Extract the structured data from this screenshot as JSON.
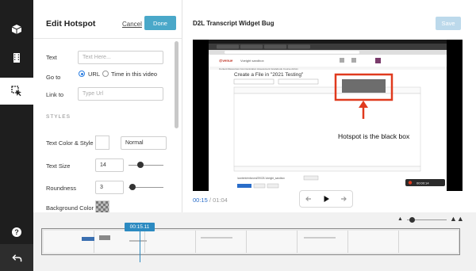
{
  "edit_panel": {
    "title": "Edit Hotspot",
    "cancel_label": "Cancel",
    "done_label": "Done",
    "text_label": "Text",
    "text_placeholder": "Text Here...",
    "goto_label": "Go to",
    "goto_options": [
      "URL",
      "Time in this video"
    ],
    "goto_selected": "URL",
    "link_label": "Link to",
    "link_placeholder": "Type Url",
    "styles_heading": "STYLES",
    "text_color_style_label": "Text Color & Style",
    "text_style_value": "Normal",
    "text_size_label": "Text Size",
    "text_size_value": "14",
    "roundness_label": "Roundness",
    "roundness_value": "3",
    "background_color_label": "Background Color"
  },
  "video_panel": {
    "title": "D2L Transcript Widget Bug",
    "save_label": "Save",
    "current_time": "00:15",
    "separator": "/",
    "duration": "01:04",
    "annotation": "Hotspot is the black box",
    "inner_page_title": "Create a File in \"2021 Testing\"",
    "inner_timestamp": "00:00:14"
  },
  "timeline": {
    "playhead_time": "00:15.11",
    "zoom_level": 0.1
  },
  "colors": {
    "done_button": "#4aa8c9",
    "playhead": "#2c8ac1",
    "hotspot_border": "#e03a1e",
    "rail": "#1e1e1e"
  },
  "rail_icons": [
    "cube-icon",
    "film-icon",
    "hotspot-cursor-icon",
    "help-icon",
    "back-arrow-icon"
  ]
}
